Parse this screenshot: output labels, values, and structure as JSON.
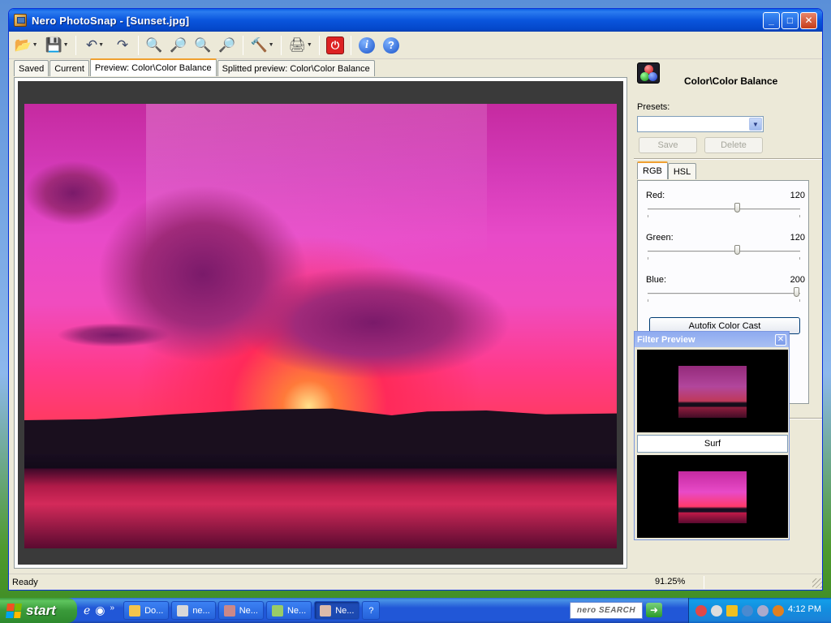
{
  "window": {
    "title": "Nero PhotoSnap - [Sunset.jpg]"
  },
  "toolbar": {
    "items": [
      "open",
      "save",
      "undo",
      "redo",
      "zoom-fit",
      "zoom-in",
      "zoom-100",
      "zoom-out",
      "tools",
      "print",
      "exit",
      "info",
      "help"
    ]
  },
  "tabs": [
    "Saved",
    "Current",
    "Preview: Color\\Color Balance",
    "Splitted preview: Color\\Color Balance"
  ],
  "panel": {
    "title": "Color\\Color Balance",
    "presets_label": "Presets:",
    "presets_value": "",
    "save_label": "Save",
    "delete_label": "Delete",
    "subtabs": [
      "RGB",
      "HSL"
    ],
    "sliders": [
      {
        "label": "Red:",
        "value": "120"
      },
      {
        "label": "Green:",
        "value": "120"
      },
      {
        "label": "Blue:",
        "value": "200"
      }
    ],
    "slider_levels": [
      120,
      120,
      200
    ],
    "slider_range": [
      0,
      200
    ],
    "autofix_label": "Autofix Color Cast"
  },
  "filter_preview": {
    "title": "Filter Preview",
    "name": "Surf"
  },
  "status": {
    "text": "Ready",
    "zoom": "91.25%"
  },
  "taskbar": {
    "start": "start",
    "tasks": [
      "Do...",
      "ne...",
      "Ne...",
      "Ne...",
      "Ne..."
    ],
    "search": "nero SEARCH",
    "clock": "4:12 PM"
  }
}
